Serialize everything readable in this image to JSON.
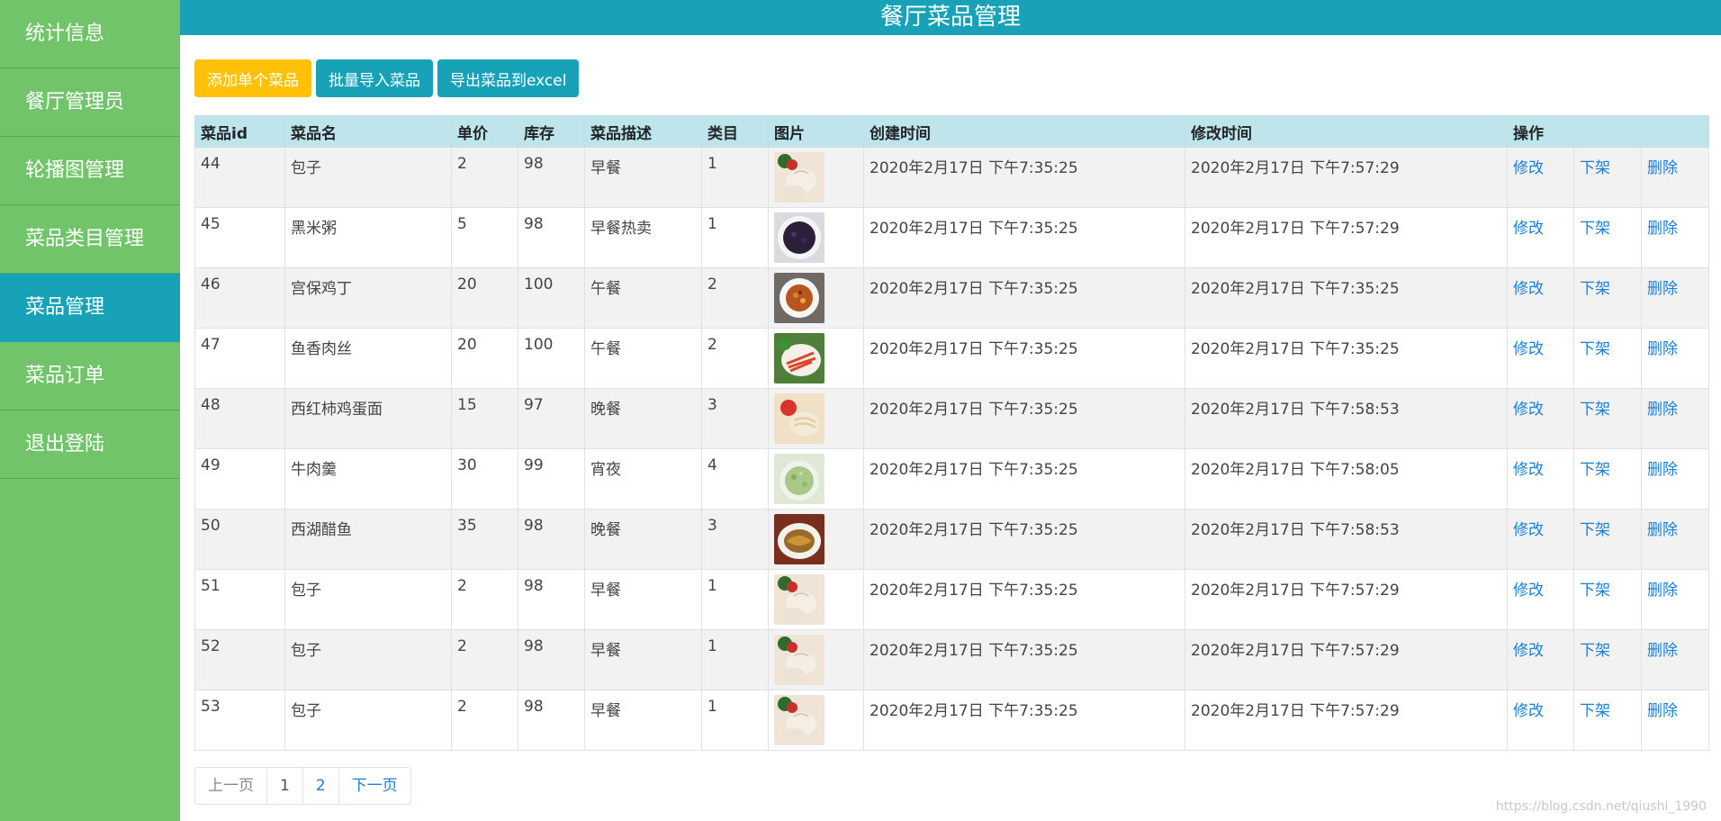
{
  "header": {
    "title": "餐厅菜品管理"
  },
  "sidebar": {
    "items": [
      {
        "label": "统计信息"
      },
      {
        "label": "餐厅管理员"
      },
      {
        "label": "轮播图管理"
      },
      {
        "label": "菜品类目管理"
      },
      {
        "label": "菜品管理",
        "active": true
      },
      {
        "label": "菜品订单"
      },
      {
        "label": "退出登陆"
      }
    ]
  },
  "toolbar": {
    "add_label": "添加单个菜品",
    "import_label": "批量导入菜品",
    "export_label": "导出菜品到excel"
  },
  "table": {
    "headers": {
      "id": "菜品id",
      "name": "菜品名",
      "price": "单价",
      "stock": "库存",
      "desc": "菜品描述",
      "category": "类目",
      "image": "图片",
      "created": "创建时间",
      "modified": "修改时间",
      "actions": "操作"
    },
    "actions": {
      "edit": "修改",
      "offshelf": "下架",
      "delete": "删除"
    },
    "rows": [
      {
        "id": "44",
        "name": "包子",
        "price": "2",
        "stock": "98",
        "desc": "早餐",
        "category": "1",
        "image": "baozi-photo",
        "created": "2020年2月17日 下午7:35:25",
        "modified": "2020年2月17日 下午7:57:29"
      },
      {
        "id": "45",
        "name": "黑米粥",
        "price": "5",
        "stock": "98",
        "desc": "早餐热卖",
        "category": "1",
        "image": "black-rice-porridge-photo",
        "created": "2020年2月17日 下午7:35:25",
        "modified": "2020年2月17日 下午7:57:29"
      },
      {
        "id": "46",
        "name": "宫保鸡丁",
        "price": "20",
        "stock": "100",
        "desc": "午餐",
        "category": "2",
        "image": "kung-pao-chicken-photo",
        "created": "2020年2月17日 下午7:35:25",
        "modified": "2020年2月17日 下午7:35:25"
      },
      {
        "id": "47",
        "name": "鱼香肉丝",
        "price": "20",
        "stock": "100",
        "desc": "午餐",
        "category": "2",
        "image": "yuxiang-pork-photo",
        "created": "2020年2月17日 下午7:35:25",
        "modified": "2020年2月17日 下午7:35:25"
      },
      {
        "id": "48",
        "name": "西红柿鸡蛋面",
        "price": "15",
        "stock": "97",
        "desc": "晚餐",
        "category": "3",
        "image": "tomato-egg-noodle-photo",
        "created": "2020年2月17日 下午7:35:25",
        "modified": "2020年2月17日 下午7:58:53"
      },
      {
        "id": "49",
        "name": "牛肉羹",
        "price": "30",
        "stock": "99",
        "desc": "宵夜",
        "category": "4",
        "image": "beef-soup-photo",
        "created": "2020年2月17日 下午7:35:25",
        "modified": "2020年2月17日 下午7:58:05"
      },
      {
        "id": "50",
        "name": "西湖醋鱼",
        "price": "35",
        "stock": "98",
        "desc": "晚餐",
        "category": "3",
        "image": "west-lake-fish-photo",
        "created": "2020年2月17日 下午7:35:25",
        "modified": "2020年2月17日 下午7:58:53"
      },
      {
        "id": "51",
        "name": "包子",
        "price": "2",
        "stock": "98",
        "desc": "早餐",
        "category": "1",
        "image": "baozi-photo",
        "created": "2020年2月17日 下午7:35:25",
        "modified": "2020年2月17日 下午7:57:29"
      },
      {
        "id": "52",
        "name": "包子",
        "price": "2",
        "stock": "98",
        "desc": "早餐",
        "category": "1",
        "image": "baozi-photo",
        "created": "2020年2月17日 下午7:35:25",
        "modified": "2020年2月17日 下午7:57:29"
      },
      {
        "id": "53",
        "name": "包子",
        "price": "2",
        "stock": "98",
        "desc": "早餐",
        "category": "1",
        "image": "baozi-photo",
        "created": "2020年2月17日 下午7:35:25",
        "modified": "2020年2月17日 下午7:57:29"
      }
    ]
  },
  "pagination": {
    "prev": "上一页",
    "pages": [
      "1",
      "2"
    ],
    "next": "下一页"
  },
  "watermark": "https://blog.csdn.net/qiushi_1990",
  "colors": {
    "sidebar": "#72c46b",
    "active": "#17a2b8",
    "header": "#17a2b8",
    "warning": "#ffc107",
    "link": "#1a7fd6",
    "table_header": "#bee5eb"
  }
}
